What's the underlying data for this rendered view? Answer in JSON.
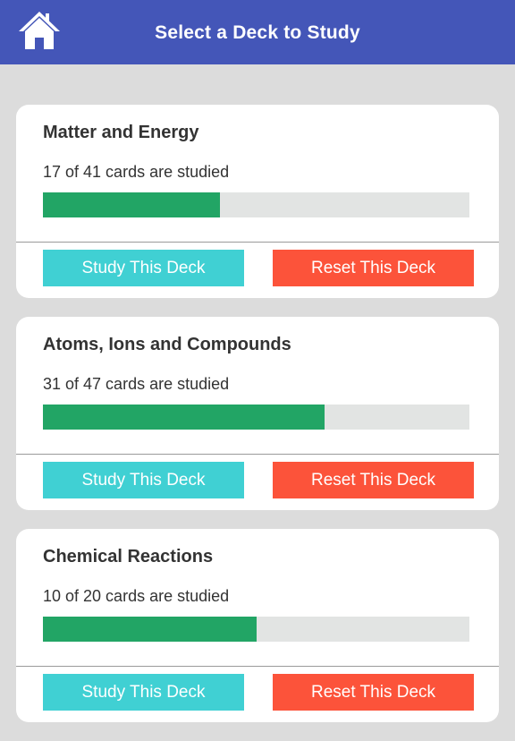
{
  "header": {
    "title": "Select a Deck to Study",
    "home_icon": "home-icon",
    "background": "#4456b8"
  },
  "colors": {
    "study_button": "#40d0d3",
    "reset_button": "#fc533a",
    "progress_fill": "#22a565",
    "progress_track": "#e2e4e3"
  },
  "decks": [
    {
      "title": "Matter and Energy",
      "progress_text": "17 of 41 cards are studied",
      "studied": 17,
      "total": 41,
      "study_label": "Study This Deck",
      "reset_label": "Reset This Deck"
    },
    {
      "title": "Atoms, Ions and Compounds",
      "progress_text": "31 of 47 cards are studied",
      "studied": 31,
      "total": 47,
      "study_label": "Study This Deck",
      "reset_label": "Reset This Deck"
    },
    {
      "title": "Chemical Reactions",
      "progress_text": "10 of 20 cards are studied",
      "studied": 10,
      "total": 20,
      "study_label": "Study This Deck",
      "reset_label": "Reset This Deck"
    }
  ]
}
